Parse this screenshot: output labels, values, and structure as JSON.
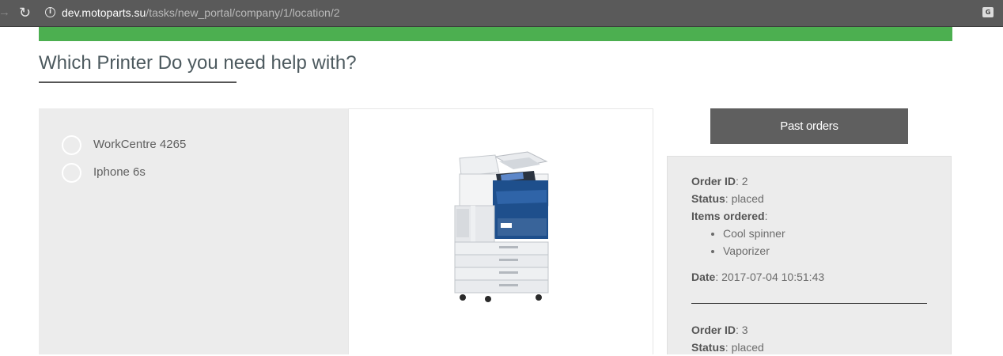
{
  "browser": {
    "url_host": "dev.motoparts.su",
    "url_path": "/tasks/new_portal/company/1/location/2"
  },
  "page": {
    "title": "Which Printer Do you need help with?"
  },
  "printers": [
    {
      "label": "WorkCentre 4265"
    },
    {
      "label": "Iphone 6s"
    }
  ],
  "past_orders": {
    "button_label": "Past orders",
    "labels": {
      "order_id": "Order ID",
      "status": "Status",
      "items_ordered": "Items ordered",
      "date": "Date"
    },
    "orders": [
      {
        "id": "2",
        "status": "placed",
        "items": [
          "Cool spinner",
          "Vaporizer"
        ],
        "date": "2017-07-04 10:51:43"
      },
      {
        "id": "3",
        "status": "placed"
      }
    ]
  },
  "colors": {
    "accent_green": "#4caf50",
    "button_gray": "#5f5f5f",
    "panel_gray": "#ececec",
    "printer_blue": "#1e4f8c"
  }
}
